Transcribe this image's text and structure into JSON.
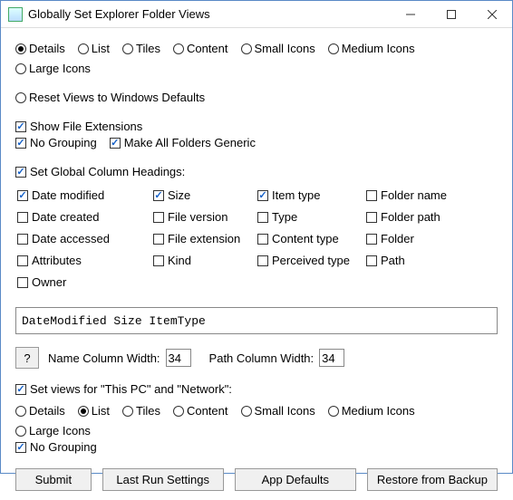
{
  "window": {
    "title": "Globally Set Explorer Folder Views"
  },
  "viewRadios": {
    "options": [
      "Details",
      "List",
      "Tiles",
      "Content",
      "Small Icons",
      "Medium Icons",
      "Large Icons"
    ],
    "selected": "Details"
  },
  "resetRadio": {
    "label": "Reset Views to Windows Defaults",
    "selected": false
  },
  "topChecks": {
    "showExt": {
      "label": "Show File Extensions",
      "checked": true
    },
    "noGrouping": {
      "label": "No Grouping",
      "checked": true
    },
    "makeGeneric": {
      "label": "Make All Folders Generic",
      "checked": true
    }
  },
  "columnHeadings": {
    "label": "Set Global Column Headings:",
    "checked": true,
    "columns": [
      {
        "label": "Date modified",
        "checked": true
      },
      {
        "label": "Size",
        "checked": true
      },
      {
        "label": "Item type",
        "checked": true
      },
      {
        "label": "Folder name",
        "checked": false
      },
      {
        "label": "Date created",
        "checked": false
      },
      {
        "label": "File version",
        "checked": false
      },
      {
        "label": "Type",
        "checked": false
      },
      {
        "label": "Folder path",
        "checked": false
      },
      {
        "label": "Date accessed",
        "checked": false
      },
      {
        "label": "File extension",
        "checked": false
      },
      {
        "label": "Content type",
        "checked": false
      },
      {
        "label": "Folder",
        "checked": false
      },
      {
        "label": "Attributes",
        "checked": false
      },
      {
        "label": "Kind",
        "checked": false
      },
      {
        "label": "Perceived type",
        "checked": false
      },
      {
        "label": "Path",
        "checked": false
      },
      {
        "label": "Owner",
        "checked": false
      }
    ],
    "textbox": "DateModified Size ItemType"
  },
  "widths": {
    "help": "?",
    "nameLabel": "Name Column Width:",
    "nameValue": "34",
    "pathLabel": "Path Column Width:",
    "pathValue": "34"
  },
  "thisPC": {
    "label": "Set views for \"This PC\" and \"Network\":",
    "checked": true,
    "options": [
      "Details",
      "List",
      "Tiles",
      "Content",
      "Small Icons",
      "Medium Icons",
      "Large Icons"
    ],
    "selected": "List",
    "noGrouping": {
      "label": "No Grouping",
      "checked": true
    }
  },
  "buttons": {
    "submit": "Submit",
    "lastRun": "Last Run Settings",
    "appDefaults": "App Defaults",
    "restore": "Restore from Backup"
  }
}
